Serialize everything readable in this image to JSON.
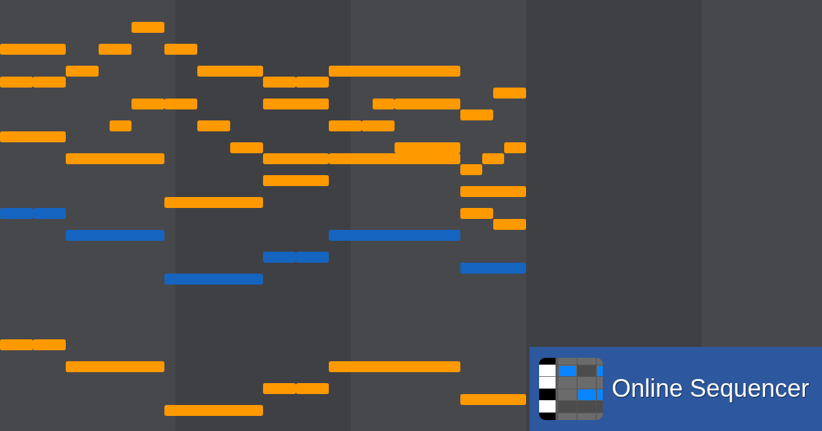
{
  "piano_roll": {
    "notes": [
      {
        "color": "#ff9900"
      },
      {
        "color": "#ff9900"
      },
      {
        "color": "#ff9900"
      },
      {
        "color": "#ff9900"
      },
      {
        "color": "#ff9900"
      },
      {
        "color": "#ff9900"
      },
      {
        "color": "#ff9900"
      },
      {
        "color": "#ff9900"
      },
      {
        "color": "#ff9900"
      },
      {
        "color": "#ff9900"
      },
      {
        "color": "#ff9900"
      },
      {
        "color": "#ff9900"
      },
      {
        "color": "#ff9900"
      },
      {
        "color": "#ff9900"
      },
      {
        "color": "#ff9900"
      },
      {
        "color": "#ff9900"
      },
      {
        "color": "#ff9900"
      },
      {
        "color": "#ff9900"
      },
      {
        "color": "#ff9900"
      },
      {
        "color": "#ff9900"
      },
      {
        "color": "#ff9900"
      },
      {
        "color": "#ff9900"
      },
      {
        "color": "#ff9900"
      },
      {
        "color": "#ff9900"
      },
      {
        "color": "#ff9900"
      },
      {
        "color": "#ff9900"
      },
      {
        "color": "#ff9900"
      },
      {
        "color": "#ff9900"
      },
      {
        "color": "#ff9900"
      },
      {
        "color": "#ff9900"
      },
      {
        "color": "#ff9900"
      },
      {
        "color": "#ff9900"
      },
      {
        "color": "#ff9900"
      },
      {
        "color": "#ff9900"
      },
      {
        "color": "#1565c0"
      },
      {
        "color": "#1565c0"
      },
      {
        "color": "#ff9900"
      },
      {
        "color": "#ff9900"
      },
      {
        "color": "#1565c0"
      },
      {
        "color": "#1565c0"
      },
      {
        "color": "#1565c0"
      },
      {
        "color": "#1565c0"
      },
      {
        "color": "#1565c0"
      },
      {
        "color": "#1565c0"
      },
      {
        "color": "#ff9900"
      },
      {
        "color": "#ff9900"
      },
      {
        "color": "#ff9900"
      },
      {
        "color": "#ff9900"
      },
      {
        "color": "#ff9900"
      },
      {
        "color": "#ff9900"
      },
      {
        "color": "#ff9900"
      },
      {
        "color": "#ff9900"
      }
    ]
  },
  "brand": {
    "name": "Online Sequencer"
  }
}
